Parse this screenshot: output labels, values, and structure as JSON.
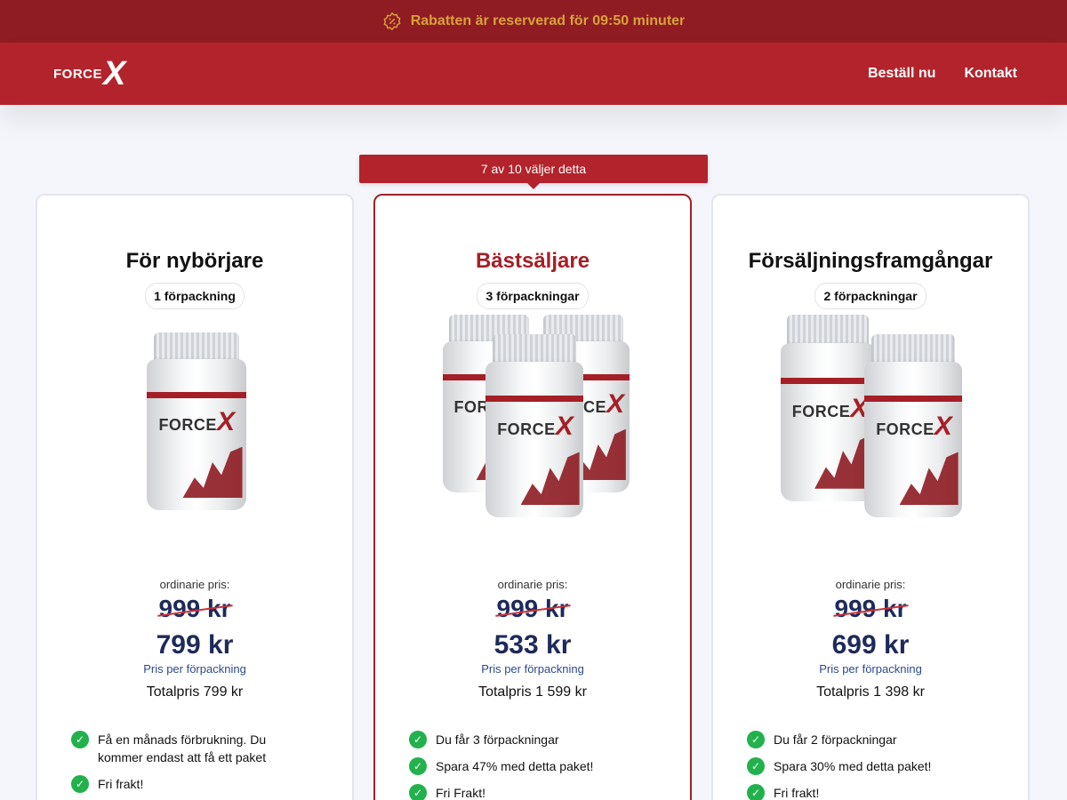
{
  "topbar": {
    "text": "Rabatten är reserverad för 09:50 minuter",
    "icon": "discount-badge-icon",
    "text_color": "#d9a23a",
    "bg": "#8e1c22"
  },
  "header": {
    "logo": {
      "word": "FORCE",
      "letter": "X"
    },
    "nav": [
      "Beställ nu",
      "Kontakt"
    ],
    "bg": "#b3232b"
  },
  "ribbon": "7 av 10 väljer detta",
  "cards": [
    {
      "title": "För nybörjare",
      "packs": "1 förpackning",
      "old_label": "ordinarie pris:",
      "old_price": "999 kr",
      "price": "799 kr",
      "per_label": "Pris per förpackning",
      "total": "Totalpris 799 kr",
      "features": [
        "Få en månads förbrukning. Du kommer endast att få ett paket",
        "Fri frakt!"
      ]
    },
    {
      "title": "Bästsäljare",
      "packs": "3 förpackningar",
      "old_label": "ordinarie pris:",
      "old_price": "999 kr",
      "price": "533 kr",
      "per_label": "Pris per förpackning",
      "total": "Totalpris 1 599 kr",
      "features": [
        "Du får 3 förpackningar",
        "Spara 47% med detta paket!",
        "Fri Frakt!"
      ]
    },
    {
      "title": "Försäljningsframgångar",
      "packs": "2 förpackningar",
      "old_label": "ordinarie pris:",
      "old_price": "999 kr",
      "price": "699 kr",
      "per_label": "Pris per förpackning",
      "total": "Totalpris 1 398 kr",
      "features": [
        "Du får 2 förpackningar",
        "Spara 30% med detta paket!",
        "Fri frakt!"
      ]
    }
  ],
  "bottle": {
    "brand": "FORCE",
    "brand_x": "X"
  },
  "colors": {
    "accent": "#a51f27",
    "price": "#1e2a5a",
    "check": "#22b14c"
  }
}
